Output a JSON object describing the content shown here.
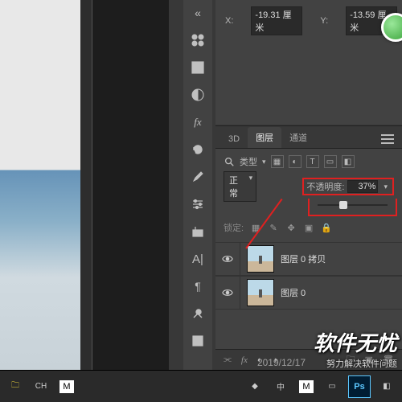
{
  "coords": {
    "x_label": "X:",
    "x_val": "-19.31 厘米",
    "y_label": "Y:",
    "y_val": "-13.59 厘米"
  },
  "tabs": {
    "t3d": "3D",
    "layers": "图层",
    "channels": "通道",
    "close": "»"
  },
  "filter": {
    "label": "类型"
  },
  "mode": {
    "blend": "正常",
    "opacity_label": "不透明度:",
    "opacity_val": "37%"
  },
  "lock": {
    "label": "锁定:"
  },
  "layers": [
    {
      "name": "图层 0 拷贝"
    },
    {
      "name": "图层 0"
    }
  ],
  "footer": {
    "fx": "fx"
  },
  "taskbar": {
    "ch": "CH",
    "m": "M",
    "zh": "中",
    "ps": "Ps"
  },
  "overlay": {
    "date": "2019/12/17"
  },
  "watermark": {
    "big": "软件无忧",
    "small": "努力解决软件问题"
  }
}
